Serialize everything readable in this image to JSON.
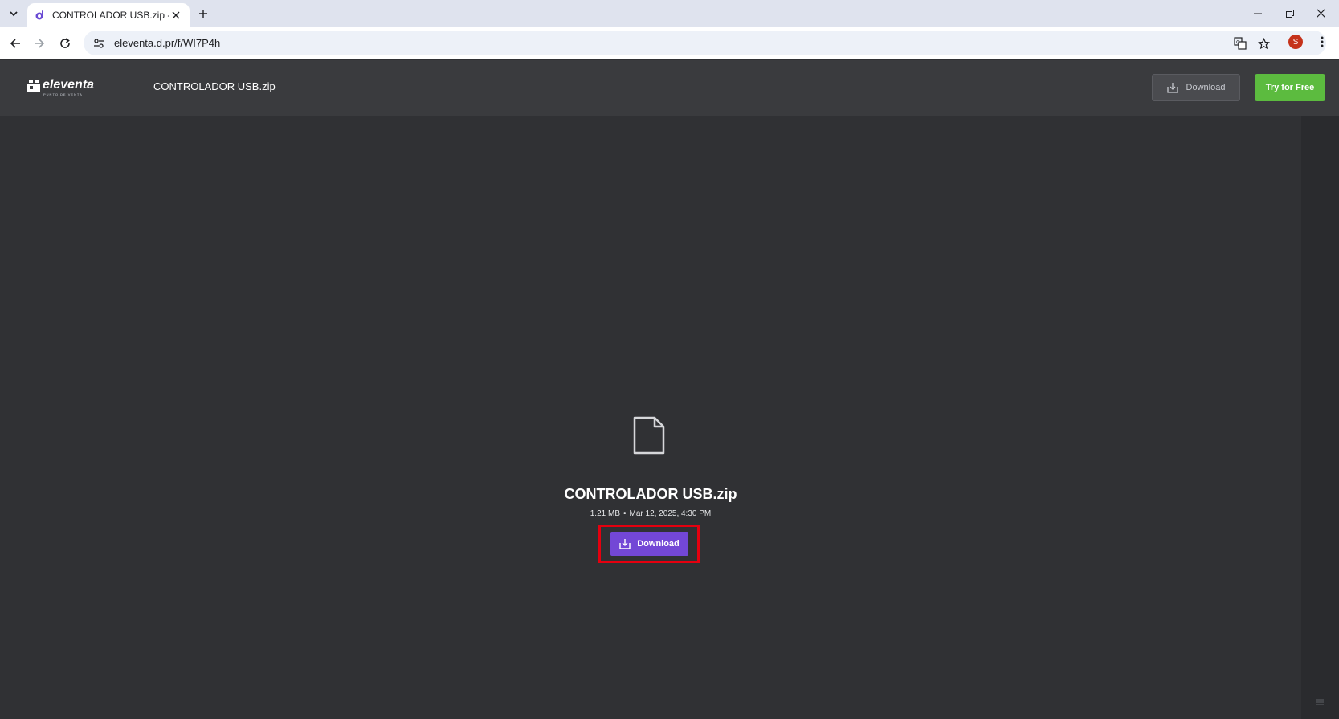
{
  "browser": {
    "tab_title": "CONTROLADOR USB.zip - Dro",
    "url": "eleventa.d.pr/f/WI7P4h",
    "profile_initial": "S"
  },
  "header": {
    "logo_text": "eleventa",
    "logo_subtext": "PUNTO DE VENTA",
    "title": "CONTROLADOR USB.zip",
    "download_label": "Download",
    "try_free_label": "Try for Free"
  },
  "file": {
    "name": "CONTROLADOR USB.zip",
    "size": "1.21 MB",
    "separator": "•",
    "date": "Mar 12, 2025, 4:30 PM",
    "download_label": "Download"
  },
  "colors": {
    "accent_purple": "#7347d6",
    "try_free_green": "#5cbb3f",
    "highlight_red": "#e5000f"
  }
}
